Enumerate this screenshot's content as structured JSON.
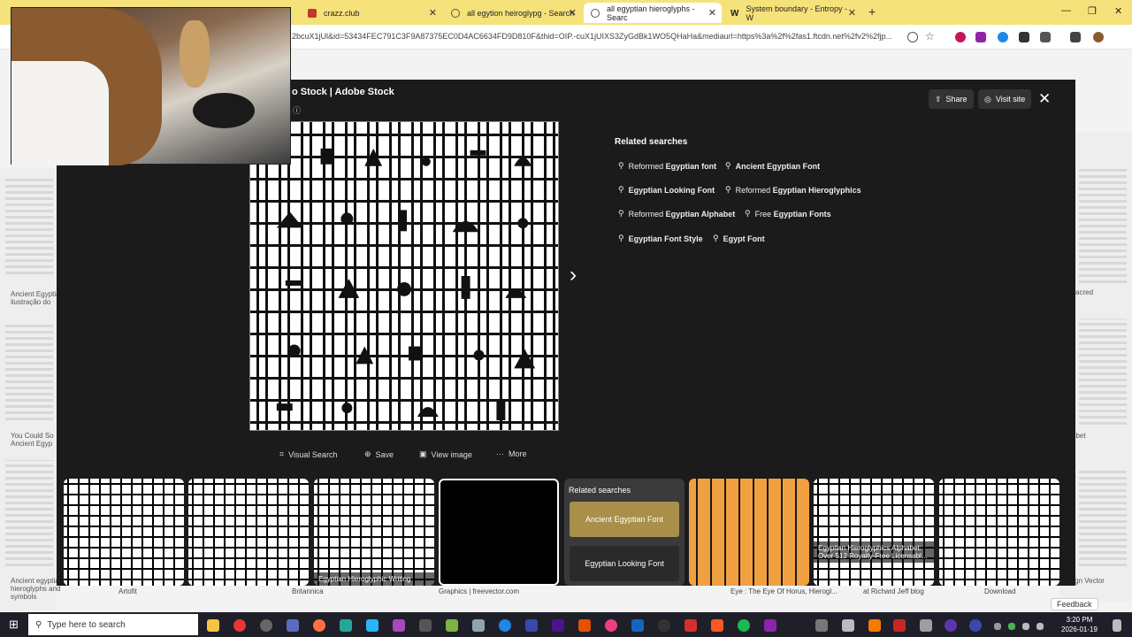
{
  "browser": {
    "tabs": [
      {
        "title": "crazz.club",
        "color": "#c0392b"
      },
      {
        "title": "all egytion heiroglypg - Search",
        "color": "#999"
      },
      {
        "title": "all egyptian hieroglyphs - Searc",
        "color": "#999",
        "active": true
      },
      {
        "title": "System boundary - Entropy - W",
        "color": "#333"
      }
    ],
    "url": "2bcuX1jUl&id=53434FEC791C3F9A87375EC0D4AC6634FD9D810F&thid=OIP.-cuX1jUIXS3ZyGdBk1WO5QHaHa&mediaurl=https%3a%2f%2fas1.ftcdn.net%2fv2%2fjp..."
  },
  "modal": {
    "title": "o Stock | Adobe Stock",
    "share_label": "Share",
    "visit_label": "Visit site",
    "related_heading": "Related searches",
    "related": [
      {
        "plain": "Reformed ",
        "bold": "Egyptian font"
      },
      {
        "plain": "",
        "bold": "Ancient Egyptian Font"
      },
      {
        "plain": "",
        "bold": "Egyptian Looking Font"
      },
      {
        "plain": "Reformed ",
        "bold": "Egyptian Hieroglyphics"
      },
      {
        "plain": "Reformed ",
        "bold": "Egyptian Alphabet"
      },
      {
        "plain": "Free ",
        "bold": "Egyptian Fonts"
      },
      {
        "plain": "",
        "bold": "Egyptian Font Style"
      },
      {
        "plain": "",
        "bold": "Egypt Font"
      }
    ],
    "actions": {
      "visual_search": "Visual Search",
      "save": "Save",
      "view_image": "View image",
      "more": "More"
    },
    "thumbs": {
      "t3_caption": "Egyptian Hieroglyphic Writing",
      "related_title": "Related searches",
      "related_a": "Ancient Egyptian Font",
      "related_b": "Egyptian Looking Font",
      "t8_caption": "Egyptian Hieroglyphics Alphabet: Over 512 Royalty-Free Licensabl..."
    }
  },
  "background": {
    "left_caption_1": "Ancient Egyptian ilustração do",
    "left_caption_2": "You Could So Ancient Egyp",
    "left_caption_3": "Ancient egyptian hieroglyphs and symbols",
    "right_caption_1": "acred",
    "right_caption_2": "abet",
    "right_caption_3": "Sign Vector",
    "under": [
      "Artofit",
      "Britannica",
      "Graphics | freevector.com",
      "Eye : The Eye Of Horus, Hierogl...",
      "at Richard Jeff blog",
      "Download"
    ],
    "feedback": "Feedback"
  },
  "taskbar": {
    "search_placeholder": "Type here to search",
    "time": "3:20 PM",
    "date": "2026-01-19"
  }
}
